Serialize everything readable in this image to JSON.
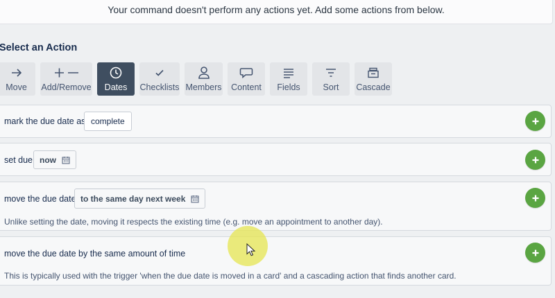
{
  "notice": "Your command doesn't perform any actions yet. Add some actions from below.",
  "section_title": "Select an Action",
  "action_buttons": [
    {
      "label": "Move",
      "icon": "arrow-right-icon",
      "active": false
    },
    {
      "label": "Add/Remove",
      "icon": "plus-minus-icon",
      "active": false
    },
    {
      "label": "Dates",
      "icon": "clock-icon",
      "active": true
    },
    {
      "label": "Checklists",
      "icon": "checkmark-icon",
      "active": false
    },
    {
      "label": "Members",
      "icon": "person-icon",
      "active": false
    },
    {
      "label": "Content",
      "icon": "speech-bubble-icon",
      "active": false
    },
    {
      "label": "Fields",
      "icon": "lines-icon",
      "active": false
    },
    {
      "label": "Sort",
      "icon": "filter-icon",
      "active": false
    },
    {
      "label": "Cascade",
      "icon": "archive-box-icon",
      "active": false
    }
  ],
  "actions": [
    {
      "text": "mark the due date as",
      "value": "complete"
    },
    {
      "text": "set due",
      "value": "now"
    },
    {
      "text": "move the due date",
      "value": "to the same day next week",
      "description": "Unlike setting the date, moving it respects the existing time (e.g. move an appointment to another day)."
    },
    {
      "text": "move the due date by the same amount of time",
      "description": "This is typically used with the trigger 'when the due date is moved in a card' and a cascading action that finds another card."
    }
  ],
  "colors": {
    "active_button": "#3f4e60",
    "add_button": "#5aa542",
    "background": "#eef0f2"
  }
}
